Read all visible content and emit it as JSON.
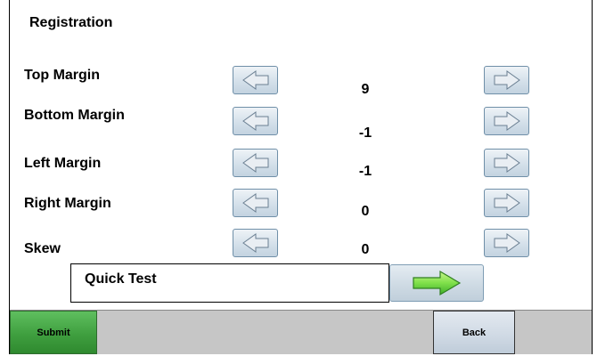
{
  "header": {
    "title": "Registration"
  },
  "rows": [
    {
      "label": "Top Margin",
      "value": "9"
    },
    {
      "label": "Bottom Margin",
      "value": "-1"
    },
    {
      "label": "Left Margin",
      "value": "-1"
    },
    {
      "label": "Right Margin",
      "value": "0"
    },
    {
      "label": "Skew",
      "value": "0"
    }
  ],
  "quick_test": {
    "label": "Quick Test"
  },
  "footer": {
    "submit_label": "Submit",
    "back_label": "Back"
  },
  "icons": {
    "decrease": "left-arrow-icon",
    "increase": "right-arrow-icon",
    "run": "green-right-arrow-icon"
  },
  "colors": {
    "submit_green": "#3f9f3f",
    "footer_gray": "#c6c6c6",
    "arrow_button_blue": "#d4e0ea",
    "run_arrow_green": "#7fe04a"
  }
}
